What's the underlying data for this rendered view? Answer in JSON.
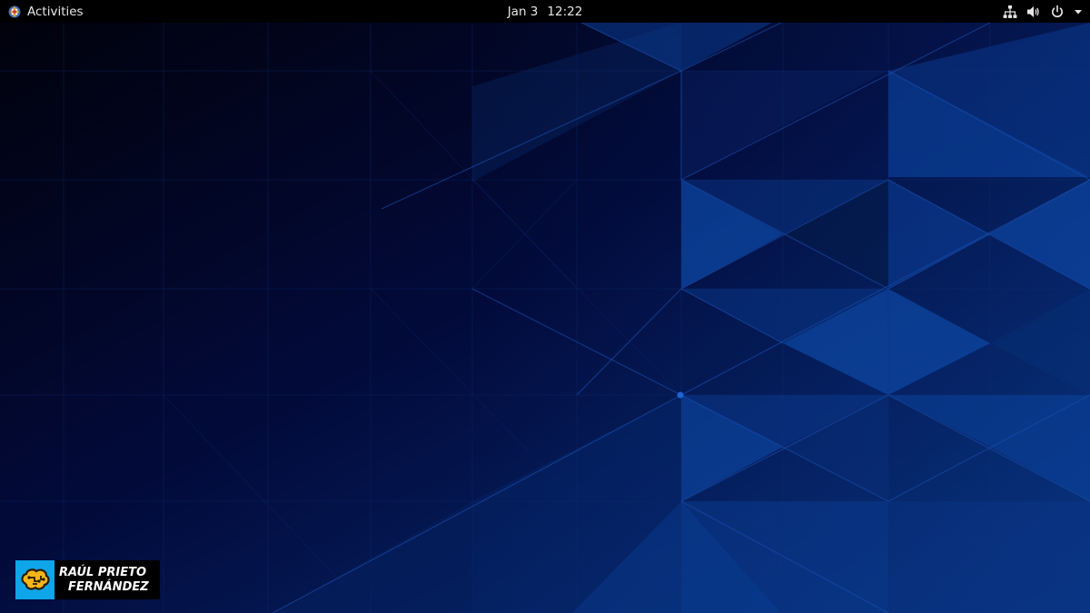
{
  "topbar": {
    "activities_label": "Activities",
    "clock": {
      "date": "Jan 3",
      "time": "12:22"
    },
    "status_icons": [
      "network-icon",
      "volume-icon",
      "power-icon",
      "chevron-down-icon"
    ]
  },
  "desktop": {
    "wallpaper_colors": [
      "#010311",
      "#020a3a",
      "#06205e",
      "#0a3a8c",
      "#1250a8"
    ]
  },
  "watermark": {
    "line1": "RAÚL PRIETO",
    "line2": "FERNÁNDEZ",
    "logo_icon": "brain-icon",
    "logo_bg": "#0ea5e9"
  }
}
